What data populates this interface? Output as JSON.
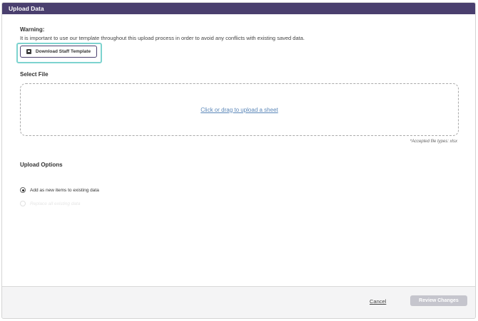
{
  "modal": {
    "title": "Upload Data"
  },
  "warning": {
    "title": "Warning:",
    "text": "It is important to use our template throughout this upload process in order to avoid any conflicts with existing saved data."
  },
  "download": {
    "label": "Download Staff Template",
    "icon": "document-icon"
  },
  "select_file": {
    "title": "Select File",
    "dropzone_text": "Click or drag to upload a sheet",
    "accepted_note": "*Accepted file types: xlsx"
  },
  "upload_options": {
    "title": "Upload Options",
    "options": [
      {
        "label": "Add as new items to existing data",
        "selected": true,
        "disabled": false
      },
      {
        "label": "Replace all existing data",
        "selected": false,
        "disabled": true
      }
    ]
  },
  "footer": {
    "cancel_label": "Cancel",
    "review_label": "Review Changes"
  },
  "colors": {
    "header_bg": "#4a3f6e",
    "focus_ring": "#7dd3cf",
    "link": "#5a86b8",
    "disabled_button": "#c5c5cd"
  }
}
